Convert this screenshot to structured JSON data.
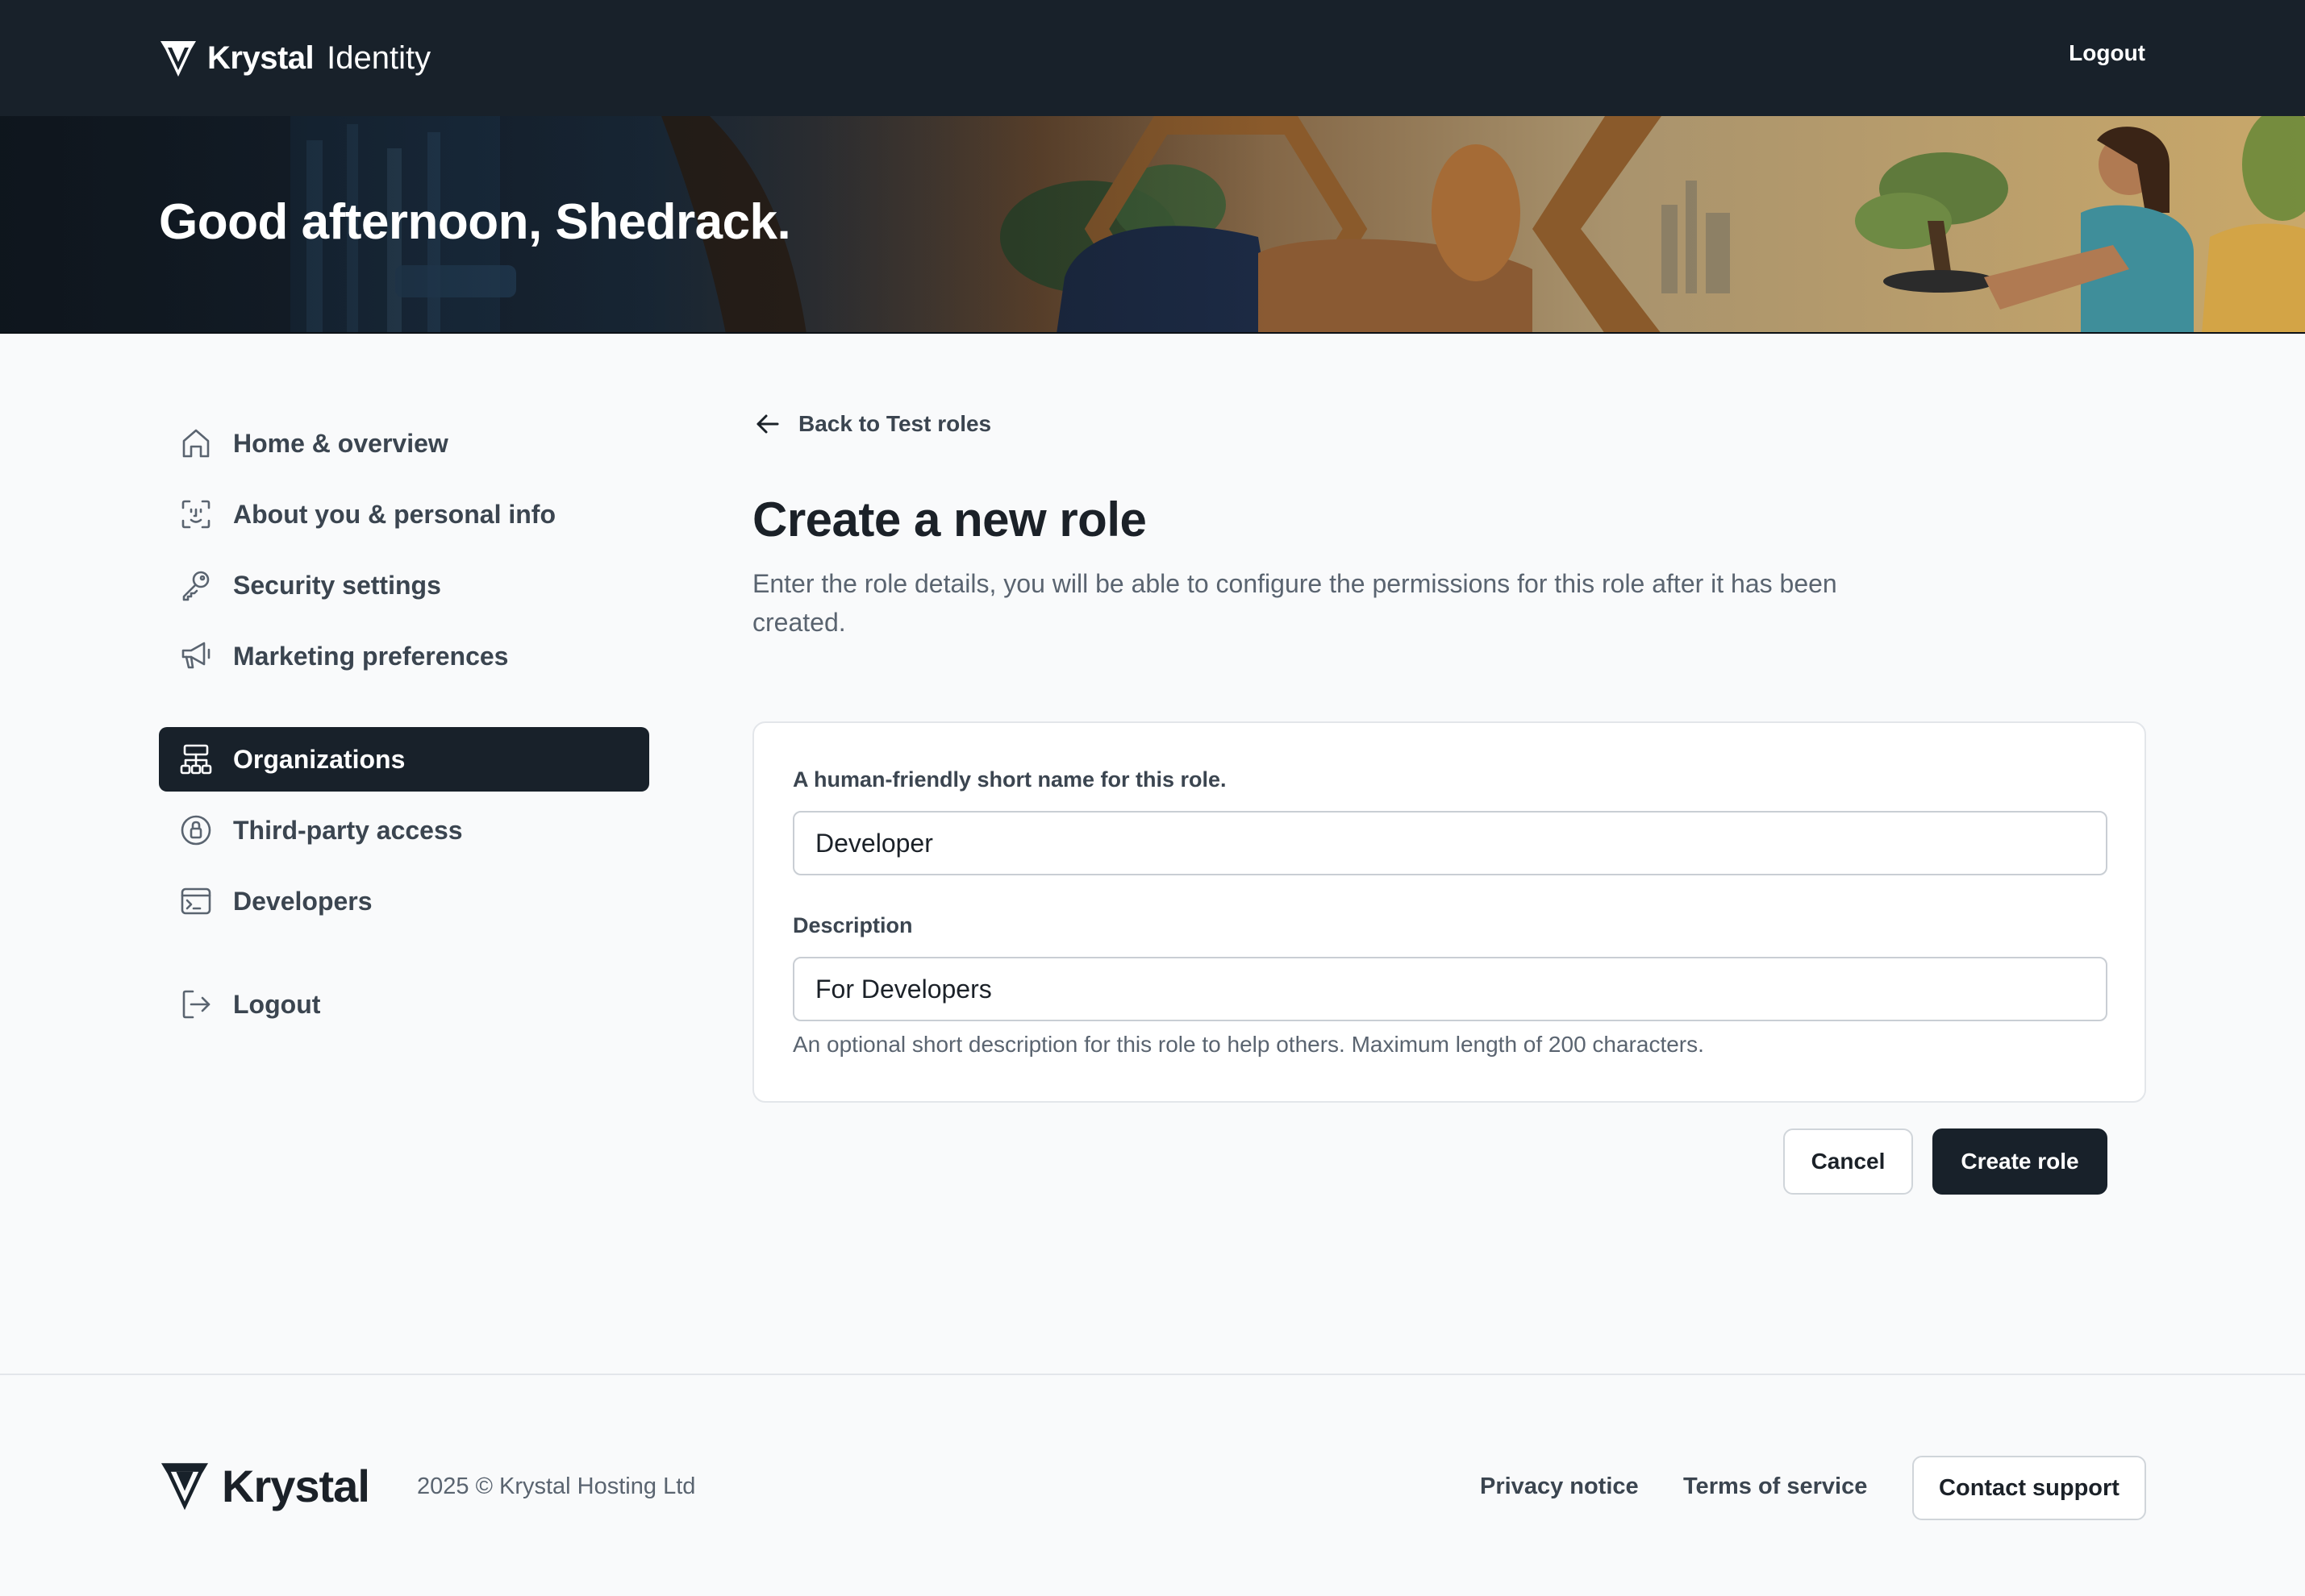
{
  "header": {
    "brand_name": "Krystal",
    "brand_sub": "Identity",
    "logout_label": "Logout"
  },
  "hero": {
    "greeting": "Good afternoon, Shedrack."
  },
  "sidebar": {
    "items": [
      {
        "label": "Home & overview",
        "icon": "home-icon"
      },
      {
        "label": "About you & personal info",
        "icon": "face-scan-icon"
      },
      {
        "label": "Security settings",
        "icon": "key-icon"
      },
      {
        "label": "Marketing preferences",
        "icon": "megaphone-icon"
      },
      {
        "label": "Organizations",
        "icon": "hierarchy-icon",
        "active": true
      },
      {
        "label": "Third-party access",
        "icon": "lock-badge-icon"
      },
      {
        "label": "Developers",
        "icon": "terminal-icon"
      },
      {
        "label": "Logout",
        "icon": "logout-icon"
      }
    ]
  },
  "main": {
    "back_label": "Back to Test roles",
    "title": "Create a new role",
    "description": "Enter the role details, you will be able to configure the permissions for this role after it has been created.",
    "form": {
      "name_label": "A human-friendly short name for this role.",
      "name_value": "Developer",
      "description_label": "Description",
      "description_value": "For Developers",
      "description_help": "An optional short description for this role to help others. Maximum length of 200 characters."
    },
    "cancel_label": "Cancel",
    "create_label": "Create role"
  },
  "footer": {
    "logo_name": "Krystal",
    "copyright": "2025 © Krystal Hosting Ltd",
    "privacy_label": "Privacy notice",
    "terms_label": "Terms of service",
    "contact_label": "Contact support"
  },
  "colors": {
    "dark": "#18212a",
    "background": "#f9fafb",
    "muted_text": "#5a6470"
  }
}
